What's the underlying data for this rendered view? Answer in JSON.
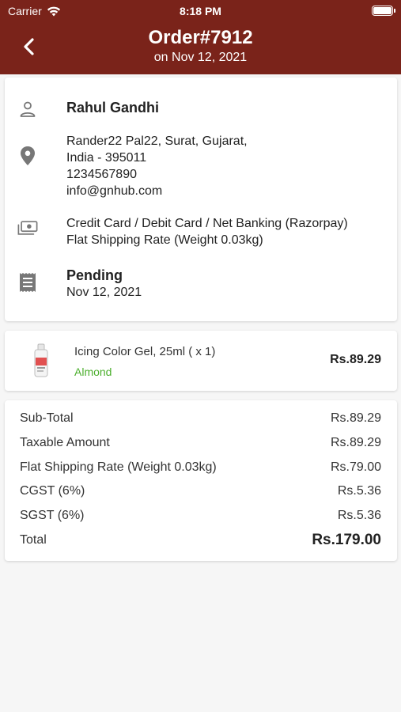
{
  "status_bar": {
    "carrier": "Carrier",
    "time": "8:18 PM"
  },
  "header": {
    "title": "Order#7912",
    "subtitle": "on Nov 12, 2021",
    "background": "#7a231a"
  },
  "customer": {
    "name": "Rahul Gandhi",
    "address_line1": "Rander22 Pal22, Surat, Gujarat,",
    "address_line2": "India - 395011",
    "phone": "1234567890",
    "email": "info@gnhub.com",
    "payment_method": "Credit Card / Debit Card / Net Banking (Razorpay)",
    "shipping_method": "Flat Shipping Rate  (Weight 0.03kg)",
    "order_status": "Pending",
    "order_date": "Nov 12, 2021"
  },
  "icons": {
    "person": "person-icon",
    "location": "location-pin-icon",
    "payment": "money-icon",
    "receipt": "receipt-icon",
    "back": "back-chevron-icon"
  },
  "product": {
    "name": "Icing Color Gel, 25ml ( x 1)",
    "variant": "Almond",
    "price": "Rs.89.29",
    "variant_color": "#4caf2e"
  },
  "summary": [
    {
      "label": "Sub-Total",
      "value": "Rs.89.29"
    },
    {
      "label": "Taxable Amount",
      "value": "Rs.89.29"
    },
    {
      "label": "Flat Shipping Rate  (Weight 0.03kg)",
      "value": "Rs.79.00"
    },
    {
      "label": "CGST (6%)",
      "value": "Rs.5.36"
    },
    {
      "label": "SGST (6%)",
      "value": "Rs.5.36"
    },
    {
      "label": "Total",
      "value": "Rs.179.00"
    }
  ]
}
